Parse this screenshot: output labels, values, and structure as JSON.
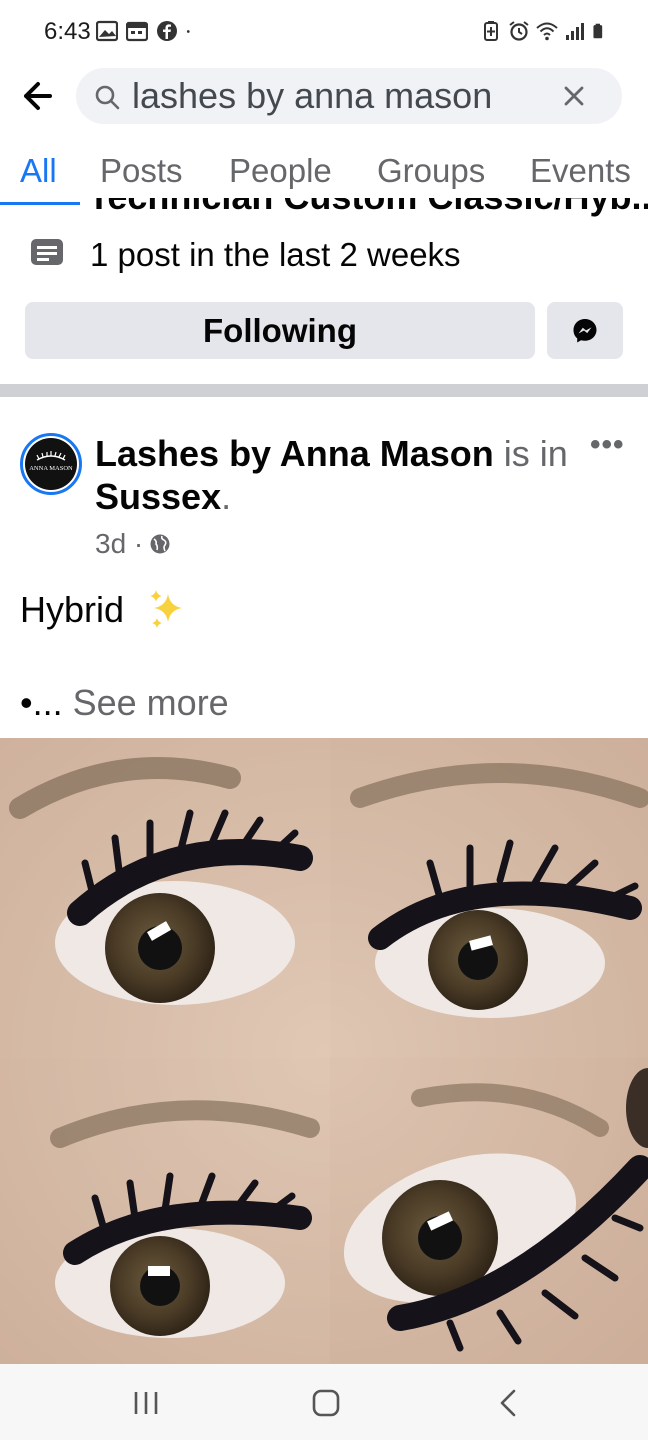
{
  "status_bar": {
    "time": "6:43",
    "left_icons": [
      "gallery-icon",
      "calendar-icon",
      "facebook-icon",
      "dot-icon"
    ],
    "right_icons": [
      "battery-saver-icon",
      "alarm-icon",
      "wifi-icon",
      "signal-icon",
      "battery-icon"
    ]
  },
  "search": {
    "query": "lashes by anna mason",
    "clear_label": "×"
  },
  "tabs": [
    {
      "label": "All",
      "active": true
    },
    {
      "label": "Posts",
      "active": false
    },
    {
      "label": "People",
      "active": false
    },
    {
      "label": "Groups",
      "active": false
    },
    {
      "label": "Events",
      "active": false
    }
  ],
  "previous_result": {
    "clipped_text": "Technician Custom Classic/Hyb..."
  },
  "page_result": {
    "activity_text": "1 post in the last 2 weeks",
    "following_label": "Following"
  },
  "post": {
    "avatar_text": "ANNA MASON",
    "author": "Lashes by Anna Mason",
    "connector": " is in ",
    "location": "Sussex",
    "end_punct": ".",
    "options_label": "•••",
    "time": "3d ·",
    "body_text": "Hybrid",
    "see_more_prefix": "•...",
    "see_more_label": "See more"
  },
  "colors": {
    "accent": "#1877f2",
    "secondary_text": "#65676b",
    "button_bg": "#e4e6eb",
    "divider": "#ced0d4"
  }
}
